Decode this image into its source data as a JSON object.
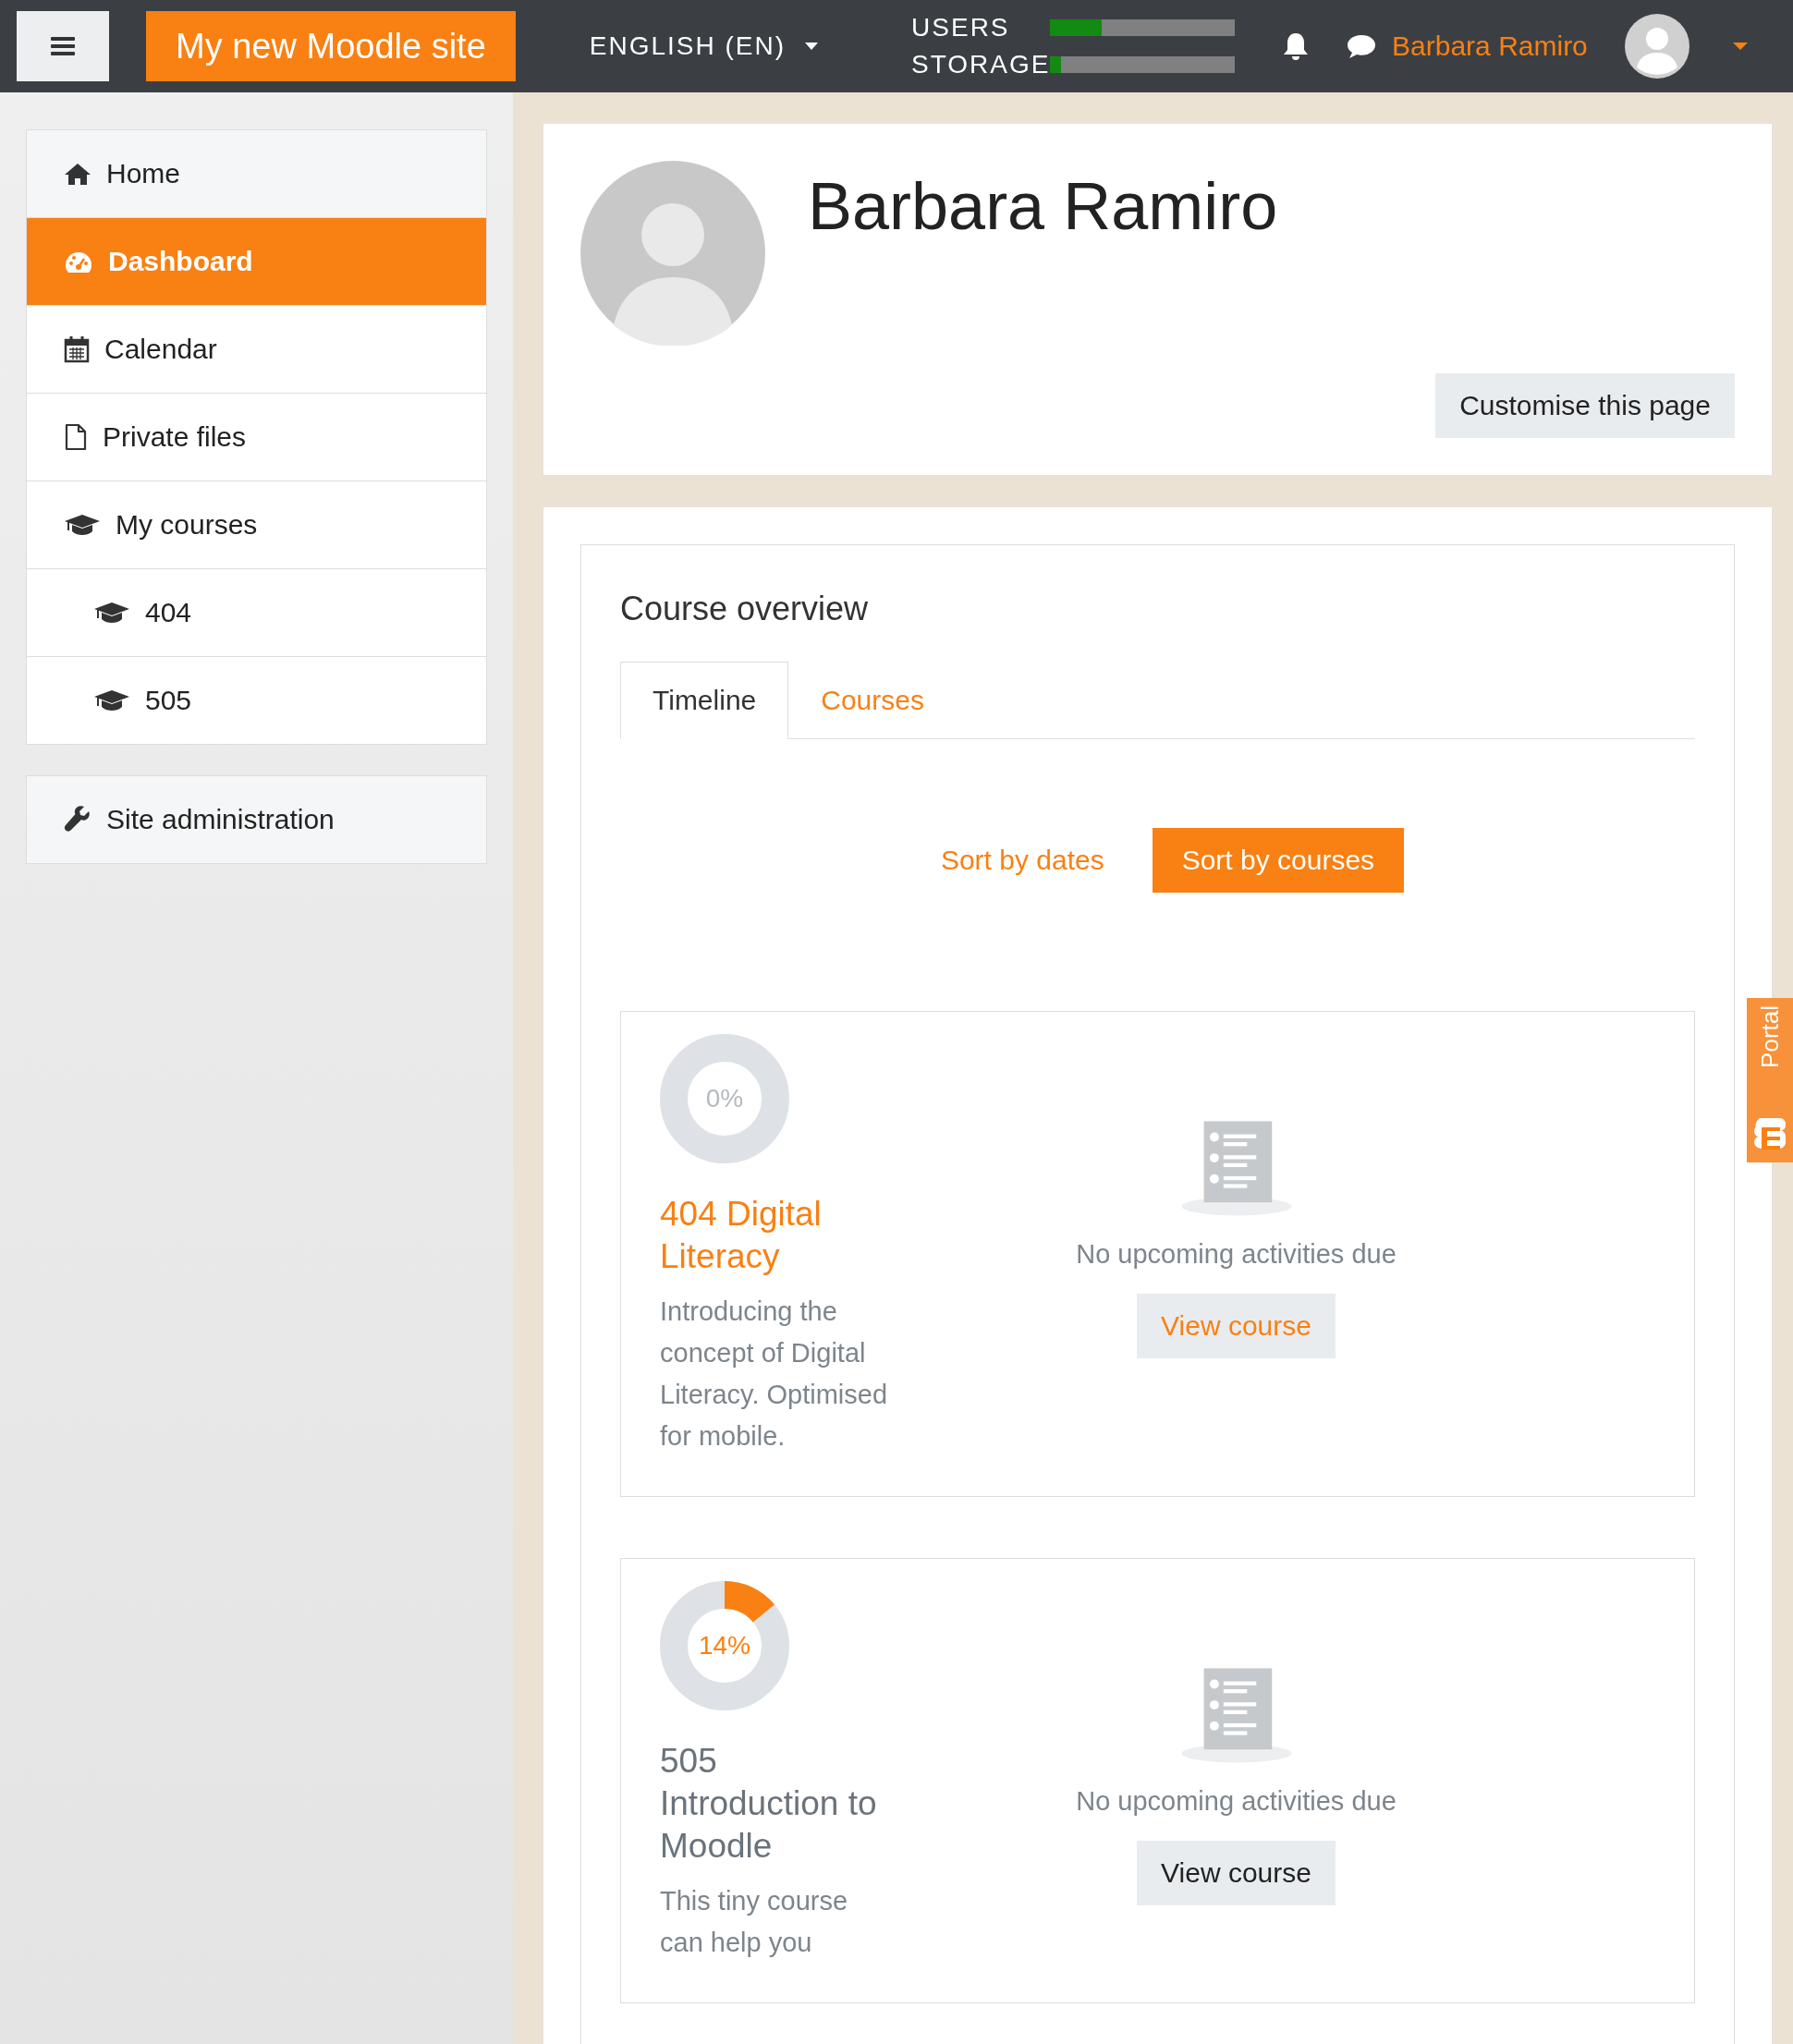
{
  "navbar": {
    "site_name": "My new Moodle site",
    "language": "ENGLISH (EN)",
    "usage": [
      {
        "label": "USERS",
        "level": 0.28
      },
      {
        "label": "STORAGE",
        "level": 0.06
      }
    ],
    "user_name": "Barbara Ramiro"
  },
  "sidebar": {
    "items": [
      {
        "kind": "home",
        "label": "Home",
        "selected": false
      },
      {
        "kind": "dashboard",
        "label": "Dashboard",
        "selected": true
      },
      {
        "kind": "calendar",
        "label": "Calendar",
        "selected": false
      },
      {
        "kind": "file",
        "label": "Private files",
        "selected": false
      },
      {
        "kind": "courses",
        "label": "My courses",
        "selected": false,
        "children": [
          {
            "kind": "courses",
            "label": "404",
            "selected": false
          },
          {
            "kind": "courses",
            "label": "505",
            "selected": false
          }
        ]
      }
    ],
    "admin": {
      "kind": "wrench",
      "label": "Site administration",
      "selected": false
    }
  },
  "profile": {
    "name": "Barbara Ramiro",
    "customise_button": "Customise this page"
  },
  "course_overview": {
    "title": "Course overview",
    "tabs": [
      {
        "label": "Timeline",
        "selected": true
      },
      {
        "label": "Courses",
        "selected": false
      }
    ],
    "sort_buttons": [
      {
        "label": "Sort by dates",
        "selected": false
      },
      {
        "label": "Sort by courses",
        "selected": true
      }
    ],
    "courses": [
      {
        "progress": "0%",
        "level": 0,
        "title": "404 Digital Literacy",
        "title_link": true,
        "description": "Introducing the concept of Digital Literacy. Optimised for mobile.",
        "status": "No upcoming activities due",
        "button": "View course",
        "button_link": true
      },
      {
        "progress": "14%",
        "level": 0.14,
        "title": "505 Introduction to Moodle",
        "title_link": false,
        "description": "This tiny course can help you",
        "status": "No upcoming activities due",
        "button": "View course",
        "button_link": false
      }
    ]
  },
  "side_tab": {
    "label": "Portal"
  }
}
